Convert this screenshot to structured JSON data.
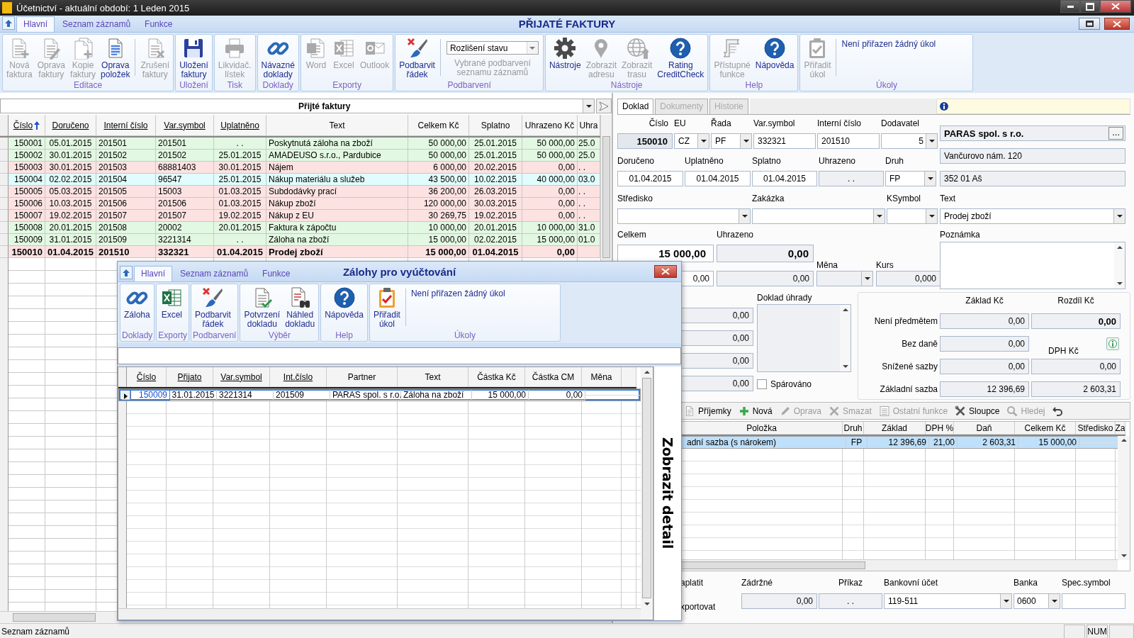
{
  "window": {
    "title": "Účetnictví  -  aktuální období:  1  Leden 2015"
  },
  "ribbon": {
    "tabs": [
      {
        "label": "Hlavní",
        "selected": true
      },
      {
        "label": "Seznam záznamů",
        "selected": false
      },
      {
        "label": "Funkce",
        "selected": false
      }
    ],
    "title": "PŘIJATÉ FAKTURY",
    "groups": [
      {
        "label": "Editace",
        "items": [
          {
            "kind": "button",
            "label": "Nová\nfaktura",
            "disabled": true
          },
          {
            "kind": "button",
            "label": "Oprava\nfaktury",
            "disabled": true
          },
          {
            "kind": "button",
            "label": "Kopie\nfaktury",
            "disabled": true
          },
          {
            "kind": "button",
            "label": "Oprava\npoložek",
            "disabled": false
          },
          {
            "kind": "separator"
          },
          {
            "kind": "button",
            "label": "Zrušení\nfaktury",
            "disabled": true
          }
        ]
      },
      {
        "label": "Uložení",
        "items": [
          {
            "kind": "button",
            "label": "Uložení\nfaktury",
            "disabled": false
          }
        ]
      },
      {
        "label": "Tisk",
        "items": [
          {
            "kind": "button",
            "label": "Likvidač.\nlístek",
            "disabled": true
          }
        ]
      },
      {
        "label": "Doklady",
        "items": [
          {
            "kind": "button",
            "label": "Návazné\ndoklady",
            "disabled": false
          }
        ]
      },
      {
        "label": "Exporty",
        "items": [
          {
            "kind": "button",
            "label": "Word",
            "disabled": true
          },
          {
            "kind": "button",
            "label": "Excel",
            "disabled": true
          },
          {
            "kind": "button",
            "label": "Outlook",
            "disabled": true
          }
        ]
      },
      {
        "label": "Podbarvení",
        "items": [
          {
            "kind": "button",
            "label": "Podbarvit\nřádek",
            "disabled": false
          },
          {
            "kind": "separator"
          },
          {
            "kind": "select",
            "value": "Rozlišení stavu",
            "caption": "Vybrané podbarvení\nseznamu záznamů"
          }
        ]
      },
      {
        "label": "Nástroje",
        "items": [
          {
            "kind": "button",
            "label": "Nástroje",
            "disabled": false
          },
          {
            "kind": "button",
            "label": "Zobrazit\nadresu",
            "disabled": true
          },
          {
            "kind": "button",
            "label": "Zobrazit\ntrasu",
            "disabled": true
          },
          {
            "kind": "button",
            "label": "Rating\nCreditCheck",
            "disabled": false
          }
        ]
      },
      {
        "label": "Help",
        "items": [
          {
            "kind": "button",
            "label": "Přístupné\nfunkce",
            "disabled": true
          },
          {
            "kind": "button",
            "label": "Nápověda",
            "disabled": false
          }
        ]
      },
      {
        "label": "Úkoly",
        "items": [
          {
            "kind": "button",
            "label": "Přiřadit\núkol",
            "disabled": true
          },
          {
            "kind": "separator"
          },
          {
            "kind": "note",
            "text": "Není přiřazen žádný úkol"
          }
        ]
      }
    ]
  },
  "list": {
    "title": "Přijté faktury",
    "columns": [
      {
        "label": "Číslo",
        "sortable": true,
        "sorted": true
      },
      {
        "label": "Doručeno",
        "sortable": true,
        "sorted": false
      },
      {
        "label": "Interní číslo",
        "sortable": true,
        "sorted": false
      },
      {
        "label": "Var.symbol",
        "sortable": true,
        "sorted": false
      },
      {
        "label": "Uplatněno",
        "sortable": true,
        "sorted": false
      },
      {
        "label": "Text",
        "sortable": false,
        "sorted": false
      },
      {
        "label": "Celkem Kč",
        "sortable": false,
        "sorted": false
      },
      {
        "label": "Splatno",
        "sortable": false,
        "sorted": false
      },
      {
        "label": "Uhrazeno Kč",
        "sortable": false,
        "sorted": false
      },
      {
        "label": "Uhra",
        "sortable": false,
        "sorted": false
      }
    ],
    "rows": [
      {
        "cells": [
          "150001",
          "05.01.2015",
          "201501",
          "201501",
          ". .",
          "Poskytnutá záloha na zboží",
          "50 000,00",
          "25.01.2015",
          "50 000,00",
          "25.0"
        ],
        "color": "#e2f8e2",
        "current": false
      },
      {
        "cells": [
          "150002",
          "30.01.2015",
          "201502",
          "201502",
          "25.01.2015",
          "AMADEUSO  s.r.o., Pardubice",
          "50 000,00",
          "25.01.2015",
          "50 000,00",
          "25.0"
        ],
        "color": "#e2f8e2",
        "current": false
      },
      {
        "cells": [
          "150003",
          "30.01.2015",
          "201503",
          "68881403",
          "30.01.2015",
          "Nájem",
          "6 000,00",
          "20.02.2015",
          "0,00",
          ". ."
        ],
        "color": "#fde2e2",
        "current": false
      },
      {
        "cells": [
          "150004",
          "02.02.2015",
          "201504",
          "96547",
          "25.01.2015",
          "Nákup materiálu a služeb",
          "43 500,00",
          "10.02.2015",
          "40 000,00",
          "03.0"
        ],
        "color": "#e0fcfc",
        "current": false
      },
      {
        "cells": [
          "150005",
          "05.03.2015",
          "201505",
          "15003",
          "01.03.2015",
          "Subdodávky prací",
          "36 200,00",
          "26.03.2015",
          "0,00",
          ". ."
        ],
        "color": "#fde2e2",
        "current": false
      },
      {
        "cells": [
          "150006",
          "10.03.2015",
          "201506",
          "201506",
          "01.03.2015",
          "Nákup zboží",
          "120 000,00",
          "30.03.2015",
          "0,00",
          ". ."
        ],
        "color": "#fde2e2",
        "current": false
      },
      {
        "cells": [
          "150007",
          "19.02.2015",
          "201507",
          "201507",
          "19.02.2015",
          "Nákup z EU",
          "30 269,75",
          "19.02.2015",
          "0,00",
          ". ."
        ],
        "color": "#fde2e2",
        "current": false
      },
      {
        "cells": [
          "150008",
          "20.01.2015",
          "201508",
          "20002",
          "20.01.2015",
          "Faktura k zápočtu",
          "10 000,00",
          "20.01.2015",
          "10 000,00",
          "31.0"
        ],
        "color": "#e2f8e2",
        "current": false
      },
      {
        "cells": [
          "150009",
          "31.01.2015",
          "201509",
          "3221314",
          ". .",
          "Záloha na zboží",
          "15 000,00",
          "02.02.2015",
          "15 000,00",
          "01.0"
        ],
        "color": "#e2f8e2",
        "current": false
      },
      {
        "cells": [
          "150010",
          "01.04.2015",
          "201510",
          "332321",
          "01.04.2015",
          "Prodej zboží",
          "15 000,00",
          "01.04.2015",
          "0,00",
          ""
        ],
        "color": "#fde2e2",
        "current": true
      }
    ]
  },
  "detail": {
    "tabs": [
      {
        "label": "Doklad",
        "selected": true,
        "disabled": false
      },
      {
        "label": "Dokumenty",
        "selected": false,
        "disabled": true
      },
      {
        "label": "Historie",
        "selected": false,
        "disabled": true
      }
    ],
    "fields": [
      {
        "label": "Číslo",
        "kind": "key",
        "value": "150010"
      },
      {
        "label": "EU",
        "kind": "combo",
        "value": "CZ"
      },
      {
        "label": "Řada",
        "kind": "combo",
        "value": "PF"
      },
      {
        "label": "Var.symbol",
        "kind": "text",
        "value": "332321"
      },
      {
        "label": "Interní číslo",
        "kind": "text",
        "value": "201510"
      },
      {
        "label": "Dodavatel",
        "kind": "combo-number",
        "value": "5"
      },
      {
        "label": "Doručeno",
        "kind": "date",
        "value": "01.04.2015"
      },
      {
        "label": "Uplatněno",
        "kind": "date",
        "value": "01.04.2015"
      },
      {
        "label": "Splatno",
        "kind": "date",
        "value": "01.04.2015"
      },
      {
        "label": "Uhrazeno",
        "kind": "readonly-date",
        "value": ". ."
      },
      {
        "label": "Druh",
        "kind": "combo",
        "value": "FP"
      },
      {
        "label": "Středisko",
        "kind": "combo"
      },
      {
        "label": "Zakázka",
        "kind": "combo"
      },
      {
        "label": "KSymbol",
        "kind": "combo"
      }
    ],
    "total": {
      "label": "Celkem",
      "value": "15 000,00"
    },
    "paid": {
      "label": "Uhrazeno",
      "value": "0,00"
    },
    "currency_row": {
      "amount": "0,00",
      "paid": "0,00",
      "currency_label": "Měna",
      "rate_label": "Kurs",
      "rate": "0,000"
    },
    "supplier": {
      "name": "PARAS spol. s r.o.",
      "button": "...",
      "street": "Vančurovo nám. 120",
      "city": "352 01 Aš"
    },
    "text": {
      "label": "Text",
      "value": "Prodej zboží"
    },
    "note": {
      "label": "Poznámka"
    },
    "amounts": [
      "0,00",
      "0,00",
      "0,00",
      "0,00"
    ],
    "payment_doc": {
      "label": "Doklad úhrady"
    },
    "paired": {
      "label": "Spárováno",
      "checked": false
    },
    "vat": {
      "header_base": "Základ Kč",
      "header_diff": "Rozdíl Kč",
      "header_tax": "DPH Kč",
      "rows": [
        {
          "label": "Není předmětem",
          "base": "0,00",
          "extra": "0,00"
        },
        {
          "label": "Bez daně",
          "base": "0,00"
        },
        {
          "label": "Snížené sazby",
          "base": "0,00",
          "extra": "0,00"
        },
        {
          "label": "Základní sazba",
          "base": "12 396,69",
          "extra": "2 603,31"
        }
      ]
    },
    "toolbar": [
      {
        "label": "Příjemky",
        "disabled": false
      },
      {
        "label": "Nová",
        "disabled": false
      },
      {
        "label": "Oprava",
        "disabled": true
      },
      {
        "label": "Smazat",
        "disabled": true
      },
      {
        "label": "Ostatní funkce",
        "disabled": true
      },
      {
        "label": "Sloupce",
        "disabled": false
      },
      {
        "label": "Hledej",
        "disabled": true
      },
      {
        "kind": "undo",
        "disabled": false
      }
    ],
    "items": {
      "columns": [
        "Položka",
        "Druh",
        "Základ",
        "DPH %",
        "Daň",
        "Celkem Kč",
        "Středisko",
        "Za"
      ],
      "rows": [
        {
          "cells": [
            "adní sazba (s nárokem)",
            "FP",
            "12 396,69",
            "21,00",
            "2 603,31",
            "15 000,00",
            "",
            ""
          ],
          "selected": true
        }
      ]
    },
    "bottom": {
      "pay_label": "aplatit",
      "export_label": "xportovat",
      "retention": {
        "label": "Zádržné",
        "value": "0,00"
      },
      "order": {
        "label": "Příkaz",
        "value": ". ."
      },
      "account": {
        "label": "Bankovní účet",
        "value": "119-511"
      },
      "bank": {
        "label": "Banka",
        "value": "0600"
      },
      "spec": {
        "label": "Spec.symbol"
      }
    }
  },
  "dialog": {
    "title": "Zálohy pro vyúčtování",
    "tabs": [
      {
        "label": "Hlavní",
        "selected": true
      },
      {
        "label": "Seznam záznamů",
        "selected": false
      },
      {
        "label": "Funkce",
        "selected": false
      }
    ],
    "groups": [
      {
        "label": "Doklady",
        "items": [
          {
            "kind": "button",
            "label": "Záloha",
            "disabled": false
          }
        ]
      },
      {
        "label": "Exporty",
        "items": [
          {
            "kind": "button",
            "label": "Excel",
            "disabled": false
          }
        ]
      },
      {
        "label": "Podbarvení",
        "items": [
          {
            "kind": "button",
            "label": "Podbarvit\nřádek",
            "disabled": false
          }
        ]
      },
      {
        "label": "Výběr",
        "items": [
          {
            "kind": "button",
            "label": "Potvrzení\ndokladu",
            "disabled": false
          },
          {
            "kind": "button",
            "label": "Náhled\ndokladu",
            "disabled": false
          }
        ]
      },
      {
        "label": "Help",
        "items": [
          {
            "kind": "button",
            "label": "Nápověda",
            "disabled": false
          }
        ]
      },
      {
        "label": "Úkoly",
        "items": [
          {
            "kind": "button",
            "label": "Přiřadit\núkol",
            "disabled": false
          },
          {
            "kind": "separator"
          },
          {
            "kind": "note",
            "text": "Není přiřazen žádný úkol"
          }
        ]
      }
    ],
    "columns": [
      "Číslo",
      "Přijato",
      "Var.symbol",
      "Int.číslo",
      "Partner",
      "Text",
      "Částka Kč",
      "Částka CM",
      "Měna"
    ],
    "rows": [
      {
        "cells": [
          "150009",
          "31.01.2015",
          "3221314",
          "201509",
          "PARAS spol. s r.o.",
          "Záloha na zboží",
          "15 000,00",
          "0,00",
          ""
        ],
        "selected": true
      }
    ],
    "side_tab": "Zobrazit detail"
  },
  "status_bar": {
    "text": "Seznam záznamů",
    "indicators": [
      "NUM"
    ]
  }
}
